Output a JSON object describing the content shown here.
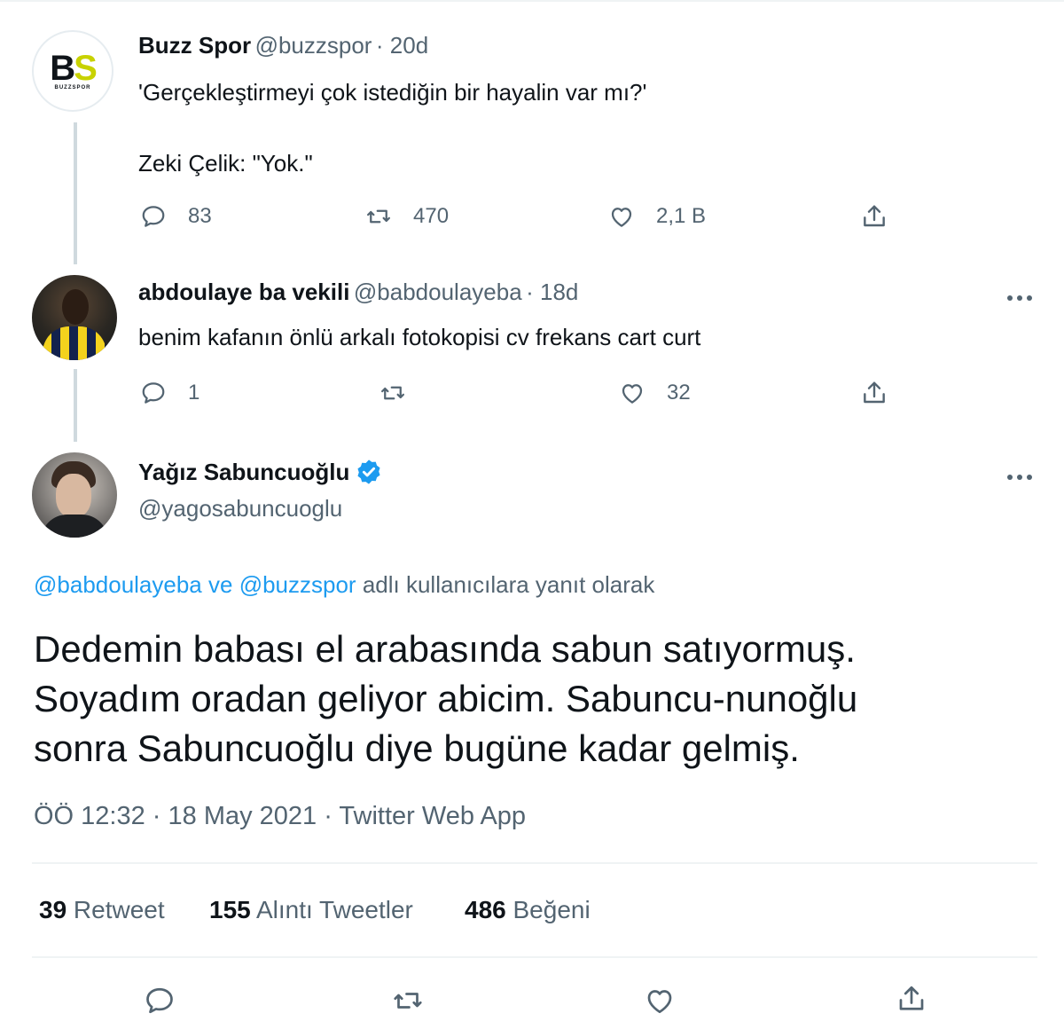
{
  "tweet1": {
    "name": "Buzz Spor",
    "handle": "@buzzspor",
    "time": "· 20d",
    "avatar_text": "BS",
    "avatar_subtext": "BUZZSPOR",
    "line1": "'Gerçekleştirmeyi çok istediğin bir hayalin var mı?'",
    "line2": "Zeki Çelik: \"Yok.\"",
    "replies": "83",
    "retweets": "470",
    "likes": "2,1 B"
  },
  "tweet2": {
    "name": "abdoulaye ba vekili",
    "handle": "@babdoulayeba",
    "time": "· 18d",
    "text": "benim kafanın önlü arkalı fotokopisi cv frekans cart curt",
    "replies": "1",
    "retweets": "",
    "likes": "32"
  },
  "main": {
    "name": "Yağız Sabuncuoğlu",
    "handle": "@yagosabuncuoglu",
    "reply_to_user1": "@babdoulayeba",
    "reply_to_sep": " ve ",
    "reply_to_user2": "@buzzspor",
    "reply_to_suffix": " adlı kullanıcılara yanıt olarak",
    "text_line1": "Dedemin babası el arabasında sabun satıyormuş.",
    "text_line2": "Soyadım oradan geliyor abicim. Sabuncu-nunoğlu",
    "text_line3": "sonra Sabuncuoğlu diye bugüne kadar gelmiş.",
    "meta": "ÖÖ 12:32 · 18 May 2021 · Twitter Web App",
    "stats": {
      "retweet_count": "39",
      "retweet_label": " Retweet",
      "quote_count": "155",
      "quote_label": " Alıntı Tweetler",
      "like_count": "486",
      "like_label": " Beğeni"
    }
  },
  "colors": {
    "link": "#1d9bf0",
    "muted": "#536471",
    "verified": "#1d9bf0"
  },
  "icons": [
    "reply-icon",
    "retweet-icon",
    "like-icon",
    "share-icon",
    "more-icon",
    "verified-badge-icon"
  ]
}
